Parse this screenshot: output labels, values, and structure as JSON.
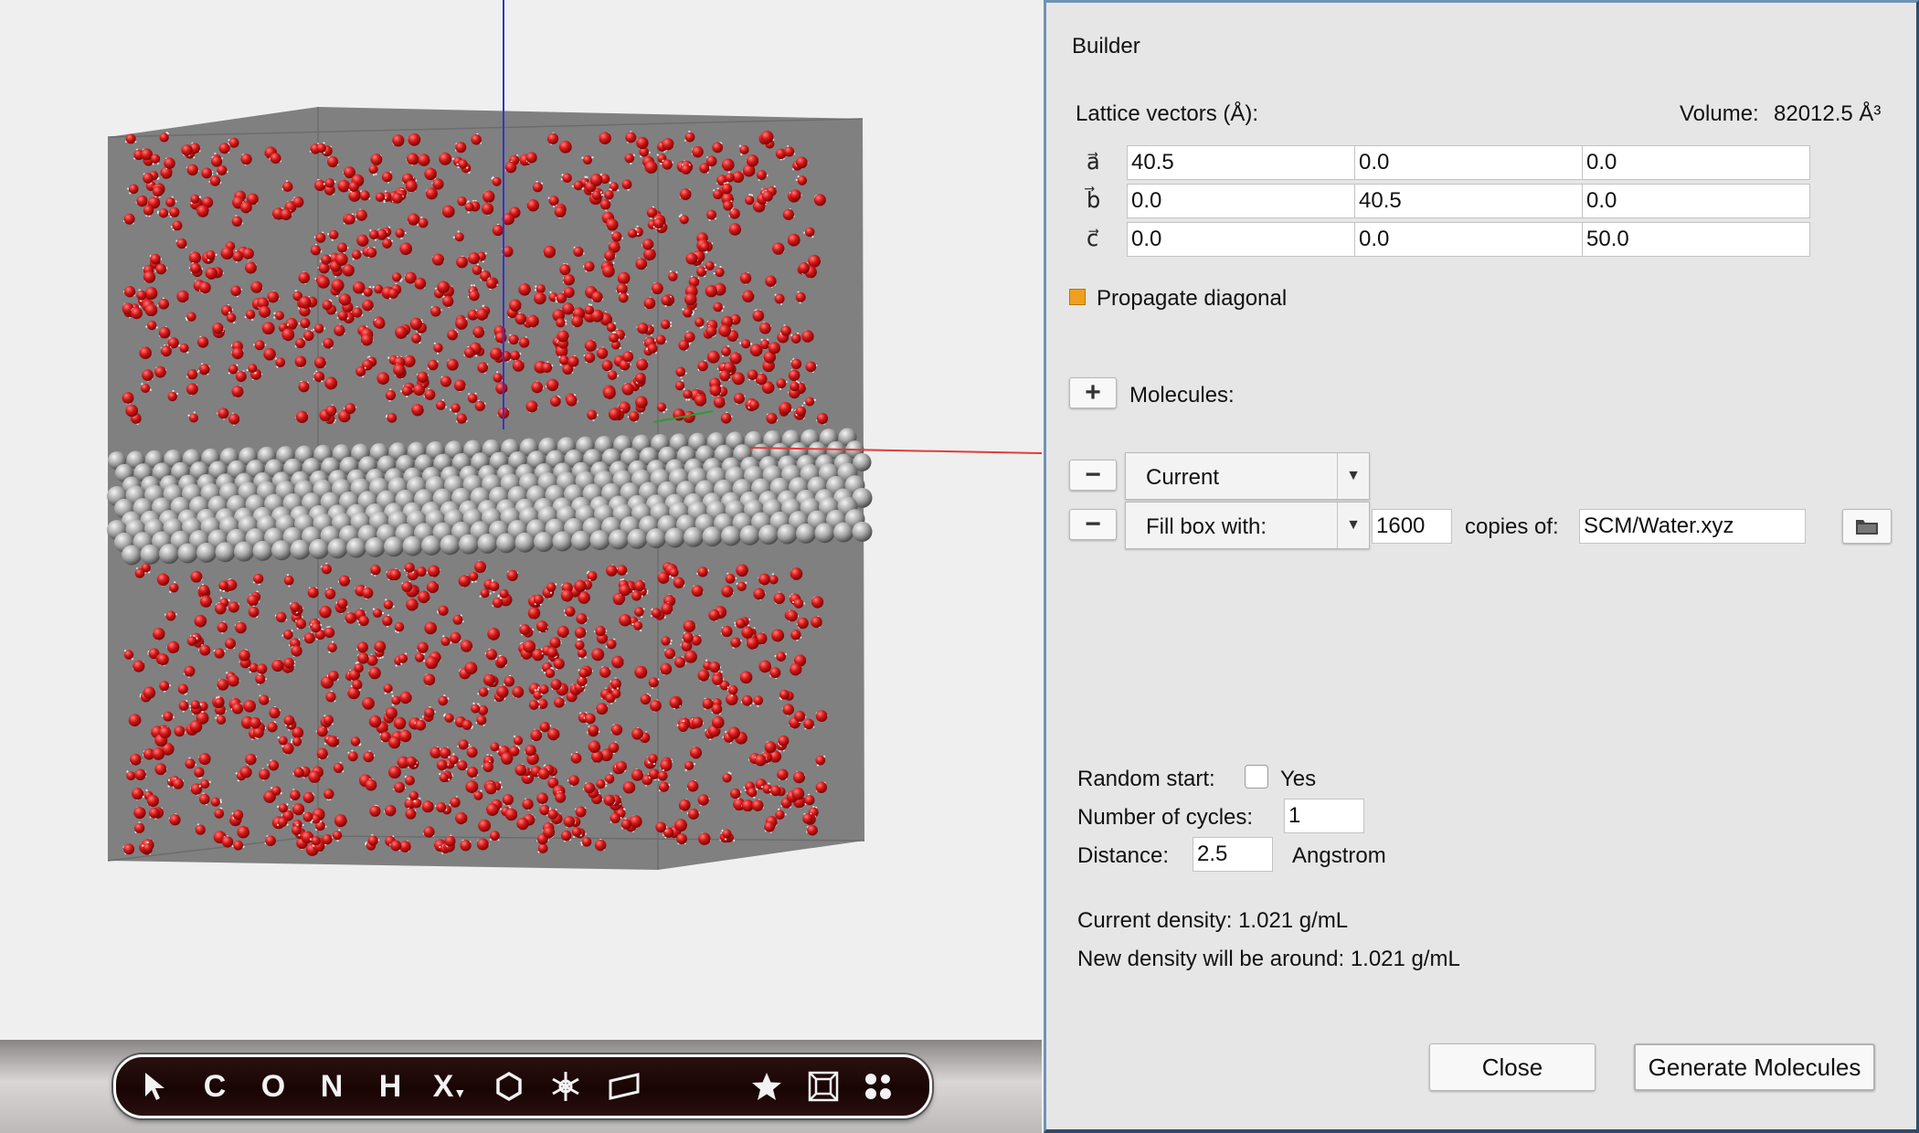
{
  "viewport": {
    "toolbar": {
      "tools": [
        {
          "name": "select",
          "label": ""
        },
        {
          "name": "carbon",
          "label": "C"
        },
        {
          "name": "oxygen",
          "label": "O"
        },
        {
          "name": "nitrogen",
          "label": "N"
        },
        {
          "name": "hydrogen",
          "label": "H"
        },
        {
          "name": "other-element",
          "label": "X"
        },
        {
          "name": "ring",
          "label": ""
        },
        {
          "name": "crystal",
          "label": ""
        },
        {
          "name": "slab",
          "label": ""
        },
        {
          "name": "favorites",
          "label": ""
        },
        {
          "name": "lattice",
          "label": ""
        },
        {
          "name": "molecules",
          "label": ""
        }
      ]
    }
  },
  "builder": {
    "title": "Builder",
    "lattice_label": "Lattice vectors (Å):",
    "volume_label": "Volume:",
    "volume_value": "82012.5 Å³",
    "vectors": [
      {
        "symbol": "a⃗",
        "values": [
          "40.5",
          "0.0",
          "0.0"
        ]
      },
      {
        "symbol": "b⃗",
        "values": [
          "0.0",
          "40.5",
          "0.0"
        ]
      },
      {
        "symbol": "c⃗",
        "values": [
          "0.0",
          "0.0",
          "50.0"
        ]
      }
    ],
    "propagate_label": "Propagate diagonal",
    "propagate_checked": false,
    "add_symbol": "+",
    "remove_symbol": "−",
    "molecules_label": "Molecules:",
    "rows": [
      {
        "type": "Current"
      },
      {
        "type": "Fill box with:",
        "copies": "1600",
        "copies_label": "copies of:",
        "file": "SCM/Water.xyz"
      }
    ],
    "random_start_label": "Random start:",
    "random_start_option": "Yes",
    "random_start_checked": false,
    "cycles_label": "Number of cycles:",
    "cycles_value": "1",
    "distance_label": "Distance:",
    "distance_value": "2.5",
    "distance_unit": "Angstrom",
    "current_density": "Current density: 1.021 g/mL",
    "new_density": "New density will be around: 1.021 g/mL",
    "close_label": "Close",
    "generate_label": "Generate Molecules",
    "colors": {
      "accent_checkbox": "#f0a020",
      "oxygen": "#d01818",
      "slab": "#9a9a9a",
      "box": "#808080"
    }
  }
}
